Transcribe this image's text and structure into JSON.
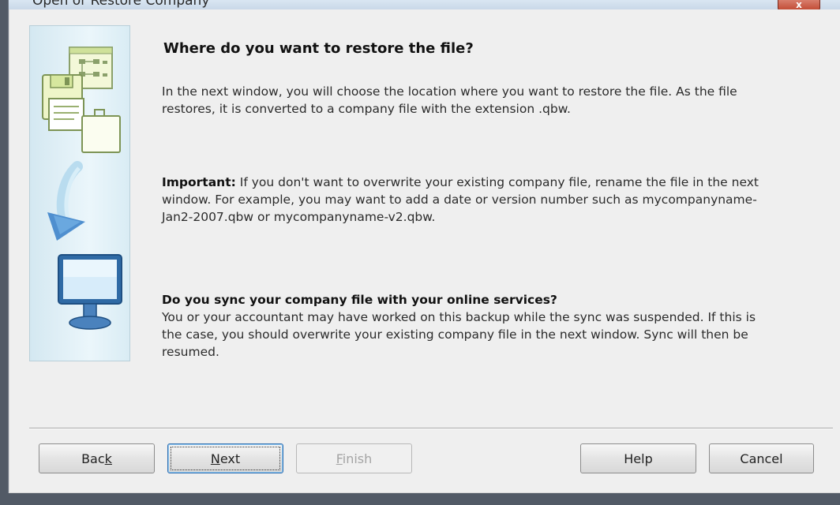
{
  "window": {
    "title": "Open or Restore Company",
    "close_glyph": "x"
  },
  "main": {
    "heading": "Where do you want to restore the file?",
    "para1": "In the next window, you will choose the location where you want to restore the file. As the file restores, it is converted to a company file with the extension .qbw.",
    "important_label": "Important:",
    "para2": " If you don't want to overwrite your existing company file, rename the file in the next window. For example, you may want to add a date or version number such as mycompanyname-Jan2-2007.qbw or mycompanyname-v2.qbw.",
    "sync_heading": "Do you sync your company file with your online services?",
    "para3": "You or your accountant may have worked on this backup while the sync was suspended. If this is the case, you should overwrite your existing company file in the next window. Sync will then be resumed."
  },
  "buttons": {
    "back_pre": "Bac",
    "back_mn": "k",
    "back_post": "",
    "next_pre": "",
    "next_mn": "N",
    "next_post": "ext",
    "finish_pre": "",
    "finish_mn": "F",
    "finish_post": "inish",
    "help": "Help",
    "cancel": "Cancel"
  },
  "icons": [
    "file-cabinet-icon",
    "floppy-disk-icon",
    "document-icon",
    "briefcase-icon",
    "curved-arrow-icon",
    "monitor-icon"
  ],
  "colors": {
    "panel": "#d4e8f1",
    "arrow": "#5b9bd5",
    "monitor": "#2a6fb0"
  }
}
